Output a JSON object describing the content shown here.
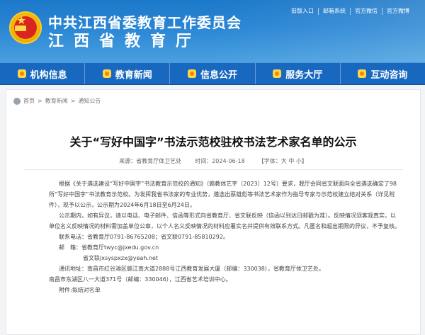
{
  "site": {
    "title_cn_party": "中共江西省委教育工作委员会",
    "title_cn_dept": "江西省教育厅",
    "top_links": [
      "旧版入口",
      "邮箱系统",
      "官方微信",
      "官方微博"
    ]
  },
  "nav": {
    "items": [
      "机构信息",
      "教育新闻",
      "信息公开",
      "服务大厅",
      "互动咨询"
    ]
  },
  "breadcrumb": [
    "首页",
    "教育新闻",
    "通知公告"
  ],
  "article": {
    "title": "关于“写好中国字”书法示范校驻校书法艺术家名单的公示",
    "source": "来源：省教育厅体卫艺处",
    "date": "时间：2024-06-18",
    "font_label": "【字体：",
    "font_big": "大",
    "font_mid": "中",
    "font_small": "小",
    "font_close": "】",
    "paragraphs": [
      "根据《关于遴选建设“写好中国字”书法教育示范校的通知》（赣教体艺字〔2023〕12号）要求，我厅会同省文联面向全省遴选确定了98所“写好中国字”书法教育示范校。为发挥我省书法家的专业优势，遴选出蔡雄彪等书法艺术家作为指导专家与示范校建立结对关系（详见附件），现予以公示，公示期为2024年6月18日至6月24日。",
      "公示期内，如有异议，请以电话、电子邮件、信函等形式向省教育厅、省文联反映（信函以到达日邮戳为准）。反映情况须客观真实，以单位名义反映情况的材料需加盖单位公章，以个人名义反映情况的材料应署实名并提供有效联系方式。凡匿名和超出期限的异议，不予复核。"
    ],
    "contact_phone": "联系电话：省教育厅0791-86765208；省文联0791-85810292。",
    "email_label": "邮　箱：",
    "email_1": "省教育厅twyc@jxedu.gov.cn",
    "email_2": "省文联jxsyspxzx@yeah.net",
    "address_1": "通讯地址：南昌市红谷滩区赣江南大道2888号江西教育发展大厦（邮编：330038），省教育厅体卫艺处。",
    "address_2": "南昌市东湖区八一大道371号（邮编：330046），江西省艺术培训中心。",
    "attachment": "附件:拟结对名单"
  }
}
